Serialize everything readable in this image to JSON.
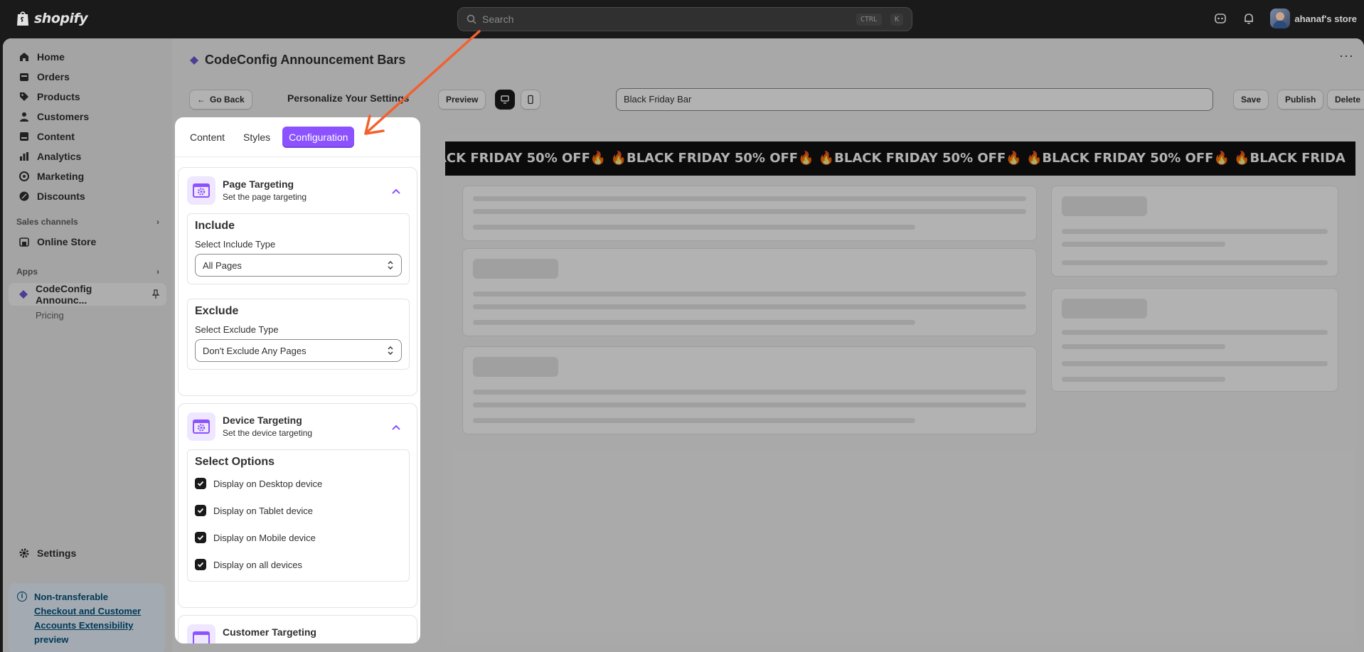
{
  "topbar": {
    "brand": "shopify",
    "search_placeholder": "Search",
    "shortcut_ctrl": "CTRL",
    "shortcut_key": "K",
    "store_name": "ahanaf's store"
  },
  "sidebar": {
    "items": [
      {
        "label": "Home",
        "icon": "home-icon"
      },
      {
        "label": "Orders",
        "icon": "orders-icon"
      },
      {
        "label": "Products",
        "icon": "tag-icon"
      },
      {
        "label": "Customers",
        "icon": "person-icon"
      },
      {
        "label": "Content",
        "icon": "content-icon"
      },
      {
        "label": "Analytics",
        "icon": "chart-icon"
      },
      {
        "label": "Marketing",
        "icon": "target-icon"
      },
      {
        "label": "Discounts",
        "icon": "discount-icon"
      }
    ],
    "sales_channels_label": "Sales channels",
    "online_store": "Online Store",
    "apps_label": "Apps",
    "app_name": "CodeConfig Announc...",
    "app_sub": "Pricing",
    "settings": "Settings",
    "notice": {
      "line1": "Non-transferable",
      "link": "Checkout and Customer Accounts Extensibility",
      "line3": "preview"
    }
  },
  "main": {
    "title": "CodeConfig Announcement Bars",
    "more": "···",
    "go_back": "Go Back",
    "personalize": "Personalize Your Settings",
    "preview_btn": "Preview",
    "bar_name": "Black Friday Bar",
    "save": "Save",
    "publish": "Publish",
    "delete": "Delete",
    "banner_text": "ACK FRIDAY 50% OFF🔥  🔥BLACK FRIDAY 50% OFF🔥  🔥BLACK FRIDAY 50% OFF🔥  🔥BLACK FRIDAY 50% OFF🔥  🔥BLACK FRIDA"
  },
  "panel": {
    "tabs": [
      "Content",
      "Styles",
      "Configuration"
    ],
    "page_targeting": {
      "title": "Page Targeting",
      "subtitle": "Set the page targeting",
      "include_title": "Include",
      "include_label": "Select Include Type",
      "include_value": "All Pages",
      "exclude_title": "Exclude",
      "exclude_label": "Select Exclude Type",
      "exclude_value": "Don't Exclude Any Pages"
    },
    "device_targeting": {
      "title": "Device Targeting",
      "subtitle": "Set the device targeting",
      "options_title": "Select Options",
      "options": [
        "Display on Desktop device",
        "Display on Tablet device",
        "Display on Mobile device",
        "Display on all devices"
      ]
    },
    "customer_targeting": {
      "title": "Customer Targeting"
    }
  },
  "colors": {
    "accent": "#8c52ff",
    "arrow": "#f2612f"
  }
}
